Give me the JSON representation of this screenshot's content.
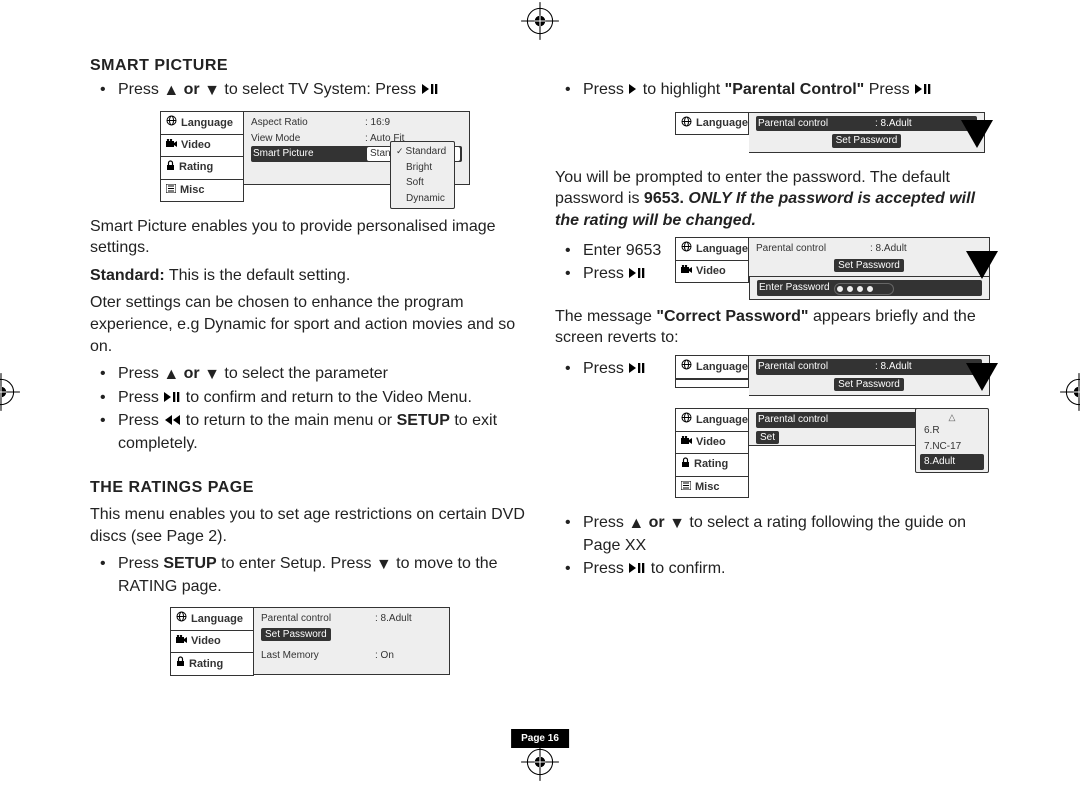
{
  "page_number": "Page 16",
  "col1": {
    "h_smart": "SMART PICTURE",
    "b_select_tv_system_pre": "Press ",
    "b_select_tv_system_mid": " or ",
    "b_select_tv_system_post": "  to select TV System: Press ",
    "para1": "Smart Picture enables you to provide personalised image settings.",
    "para2_a": "Standard:",
    "para2_b": " This is the default setting.",
    "para3": "Oter settings can be chosen to enhance the program experience, e.g Dynamic for sport and action movies  and so on.",
    "b_param_pre": "Press ",
    "b_param_mid": " or ",
    "b_param_post": "  to select the parameter",
    "b_confirm_pre": "Press ",
    "b_confirm_post": " to confirm and return to the Video Menu.",
    "b_return_pre": "Press ",
    "b_return_mid": " to return to the main menu or ",
    "b_return_setup": "SETUP",
    "b_return_post": " to exit completely.",
    "h_ratings": "THE RATINGS PAGE",
    "para4": "This menu enables you to set age restrictions on certain DVD discs (see Page 2).",
    "b_setup_pre": "Press ",
    "b_setup_a": "SETUP",
    "b_setup_mid": " to enter Setup. Press ",
    "b_setup_post": "  to move to the RATING page.",
    "osd1": {
      "side": [
        "Language",
        "Video",
        "Rating",
        "Misc"
      ],
      "rows": [
        {
          "lab": "Aspect Ratio",
          "val": ": 16:9"
        },
        {
          "lab": "View Mode",
          "val": ": Auto Fit"
        },
        {
          "lab": "Smart Picture",
          "val": "Standard",
          "hi": true
        }
      ],
      "popup": [
        "Standard",
        "Bright",
        "Soft",
        "Dynamic"
      ]
    },
    "osd2": {
      "side": [
        "Language",
        "Video",
        "Rating"
      ],
      "rows": [
        {
          "lab": "Parental control",
          "val": ": 8.Adult"
        },
        {
          "lab": "Set  Password",
          "btn": true
        },
        {
          "lab": "Last Memory",
          "val": ": On"
        }
      ]
    }
  },
  "col2": {
    "b_highlight_pre": "Press ",
    "b_highlight_mid": " to highlight ",
    "b_highlight_q": "\"Parental Control\"",
    "b_highlight_press": "  Press ",
    "para1a": "You will be prompted to enter the password. The default password is ",
    "para1b": "9653.",
    "para1c": " ONLY If the password is accepted will the rating will be changed.",
    "b_enter": "Enter 9653",
    "b_press_a": "Press ",
    "para2a": "The message ",
    "para2b": "\"Correct Password\"",
    "para2c": " appears briefly and the screen reverts to:",
    "b_press_b": "Press ",
    "b_select_rating_pre": "Press ",
    "b_select_rating_mid": " or ",
    "b_select_rating_post": "  to select a rating following the guide on Page XX",
    "b_confirm2_pre": "Press ",
    "b_confirm2_post": "  to confirm.",
    "osd_a": {
      "side": [
        "Language"
      ],
      "rows": [
        {
          "lab": "Parental control",
          "val": ": 8.Adult",
          "hi": true
        },
        {
          "lab": "Set  Password",
          "btn": true
        }
      ]
    },
    "osd_b": {
      "side": [
        "Language",
        "Video"
      ],
      "rows": [
        {
          "lab": "Parental control",
          "val": ": 8.Adult"
        },
        {
          "lab": "Set  Password",
          "btn": true
        },
        {
          "lab": "Enter Password",
          "pw": true,
          "hi": true
        }
      ]
    },
    "osd_c": {
      "side": [
        "Language"
      ],
      "rows": [
        {
          "lab": "Parental control",
          "val": ": 8.Adult",
          "hi": true
        },
        {
          "lab": "Set  Password",
          "btn": true
        }
      ]
    },
    "osd_d": {
      "side": [
        "Language",
        "Video",
        "Rating",
        "Misc"
      ],
      "rows": [
        {
          "lab": "Parental control",
          "val": "",
          "hi": true
        },
        {
          "lab": "Set",
          "btn2": true
        }
      ],
      "popup": [
        "6.R",
        "7.NC-17",
        "8.Adult"
      ]
    }
  }
}
